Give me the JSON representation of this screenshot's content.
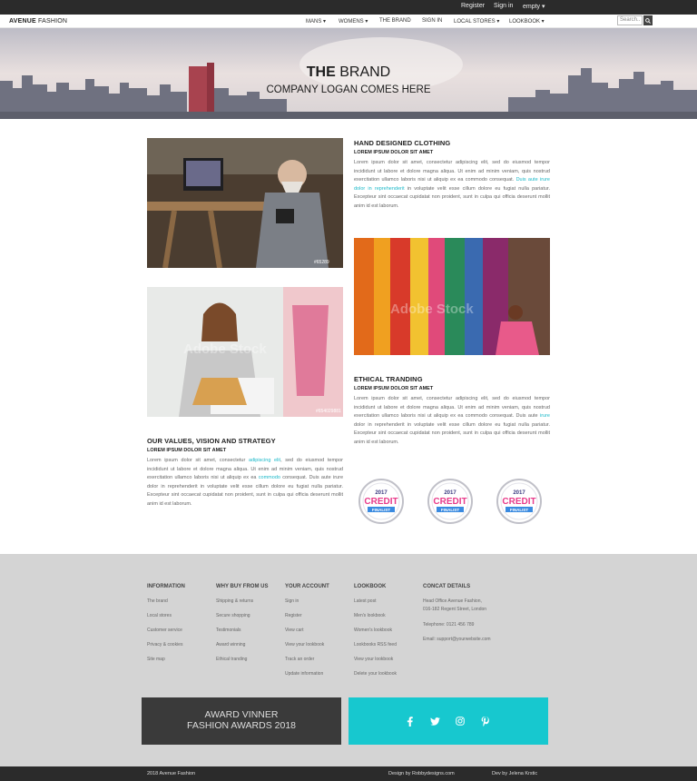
{
  "topbar": {
    "register": "Register",
    "signin": "Sign in",
    "cart": "empty"
  },
  "brand": {
    "logo_bold": "AVENUE",
    "logo_rest": " FASHION"
  },
  "nav": {
    "items": [
      "MANS",
      "WOMENS",
      "THE BRAND",
      "SIGN IN",
      "LOCAL STORES",
      "LOOKBOOK"
    ],
    "search_placeholder": "Search.."
  },
  "hero": {
    "title_bold": "THE",
    "title_rest": " BRAND",
    "subtitle": "COMPANY LOGAN COMES HERE"
  },
  "sections": {
    "hand": {
      "title": "HAND DESIGNED CLOTHING",
      "subtitle": "LOREM IPSUM DOLOR SIT AMET",
      "text_a": "Lorem ipsum dolor sit amet, consectetur adipiscing elit, sed do eiusmod tempor incididunt ut labore et dolore magna aliqua. Ut enim ad minim veniam, quis nostrud exercitation ullamco laboris nisi ut aliquip ex ea commodo consequat. ",
      "link": "Duis aute irure dolor in reprehenderit",
      "text_b": " in voluptate velit esse cillum dolore eu fugiat nulla pariatur. Excepteur sint occaecat cupidatat non proident, sunt in culpa qui officia deserunt mollit anim id est laborum."
    },
    "ethical": {
      "title": "ETHICAL TRANDING",
      "subtitle": "LOREM IPSUM DOLOR SIT AMET",
      "text_a": "Lorem ipsum dolor sit amet, consectetur adipiscing elit, sed do eiusmod tempor incididunt ut labore et dolore magna aliqua. Ut enim ad minim veniam, quis nostrud exercitation ullamco laboris nisi ut aliquip ex ea commodo consequat. Duis aute ",
      "link": "irure",
      "text_b": " dolor in reprehenderit in voluptate velit esse cillum dolore eu fugiat nulla pariatur. Excepteur sint occaecat cupidatat non proident, sunt in culpa qui officia deserunt mollit anim id est laborum."
    },
    "values": {
      "title": "OUR VALUES, VISION AND STRATEGY",
      "subtitle": "LOREM IPSUM DOLOR SIT AMET",
      "text_a": "Lorem ipsum dolor sit amet, consectetur ",
      "link1": "adipiscing elit",
      "text_b": ", sed do eiusmod tempor incididunt ut labore et dolore magna aliqua. Ut enim ad minim veniam, quis nostrud exercitation ullamco laboris nisi ut aliquip ex ea ",
      "link2": "commodo",
      "text_c": " consequat. Duis aute irure dolor in reprehenderit in voluptate velit esse cillum dolore eu fugiat nulla pariatur. Excepteur sint occaecat cupidatat non proident, sunt in culpa qui officia deserunt mollit anim id est laborum."
    }
  },
  "images": {
    "stock_watermark": "Adobe Stock",
    "id1": "#65289",
    "id2": "#654029881"
  },
  "badges": {
    "year": "2017",
    "word": "CREDIT",
    "label": "FINALIST"
  },
  "footer": {
    "columns": [
      {
        "title": "INFORMATION",
        "items": [
          "The brand",
          "Local stores",
          "Customer service",
          "Privacy & cookies",
          "Site map"
        ]
      },
      {
        "title": "WHY BUY FROM US",
        "items": [
          "Shipping & returns",
          "Secure shopping",
          "Testimonials",
          "Award winning",
          "Ethical tranding"
        ]
      },
      {
        "title": "YOUR ACCOUNT",
        "items": [
          "Sign in",
          "Register",
          "View cart",
          "View your lookbook",
          "Track an order",
          "Update information"
        ]
      },
      {
        "title": "LOOKBOOK",
        "items": [
          "Latest post",
          "Men's lookbook",
          "Women's lookbook",
          "Lookbooks RSS feed",
          "View your lookbook",
          "Delete your lookbook"
        ]
      },
      {
        "title": "CONCAT DETAILS",
        "items": [
          "Head Office Avenue Fashion,",
          "016-182 Regent Street, London",
          "Telephone: 0121 456 789",
          "Email: support@yourwebsite.com"
        ]
      }
    ],
    "award_line1": "AWARD VINNER",
    "award_line2": "FASHION AWARDS 2018",
    "social": [
      "facebook-icon",
      "twitter-icon",
      "instagram-icon",
      "pinterest-icon"
    ]
  },
  "bottom": {
    "copyright": "2018 Avenue Fashion",
    "design": "Design by Robbydesigns.com",
    "dev": "Dev by Jelena Krstic"
  },
  "colors": {
    "accent": "#17c8cf",
    "dark": "#2b2b2b",
    "footer_bg": "#d4d4d4"
  }
}
